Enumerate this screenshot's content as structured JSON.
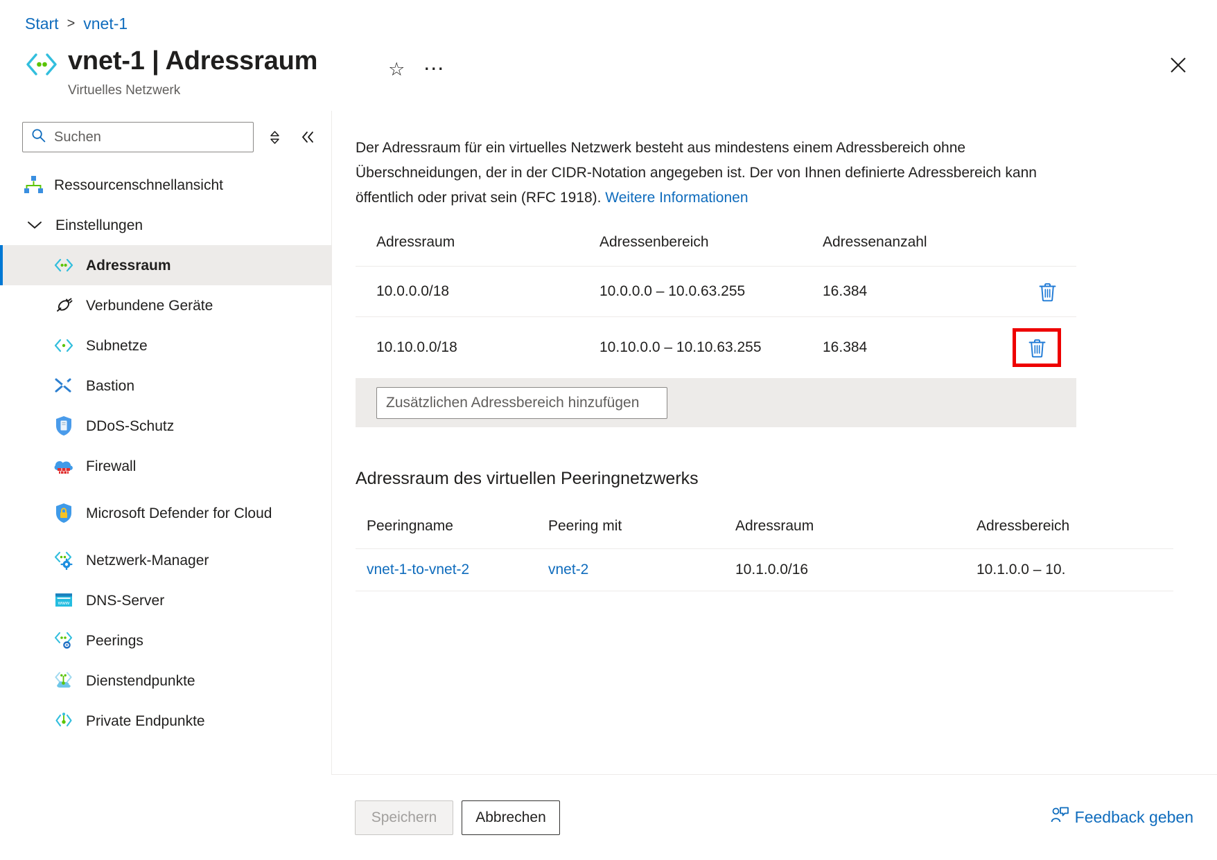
{
  "breadcrumb": {
    "home": "Start",
    "separator": ">",
    "current": "vnet-1"
  },
  "header": {
    "title": "vnet-1 | Adressraum",
    "subtitle": "Virtuelles Netzwerk",
    "favorite_icon": "star-icon",
    "more_icon": "ellipsis-icon",
    "close_icon": "close-icon",
    "resource_icon": "virtual-network-icon"
  },
  "search": {
    "placeholder": "Suchen",
    "value": "",
    "search_icon": "search-icon",
    "expand_icon": "expand-collapse-icon",
    "collapse_icon": "double-chevron-left-icon"
  },
  "sidebar": {
    "items": [
      {
        "label": "Ressourcenschnellansicht",
        "icon": "resource-visualizer-icon",
        "level": "top",
        "selected": false
      },
      {
        "label": "Einstellungen",
        "icon": "chevron-down-icon",
        "level": "group",
        "selected": false
      },
      {
        "label": "Adressraum",
        "icon": "address-space-icon",
        "level": "child",
        "selected": true
      },
      {
        "label": "Verbundene Geräte",
        "icon": "connected-devices-icon",
        "level": "child",
        "selected": false
      },
      {
        "label": "Subnetze",
        "icon": "subnets-icon",
        "level": "child",
        "selected": false
      },
      {
        "label": "Bastion",
        "icon": "bastion-icon",
        "level": "child",
        "selected": false
      },
      {
        "label": "DDoS-Schutz",
        "icon": "ddos-shield-icon",
        "level": "child",
        "selected": false
      },
      {
        "label": "Firewall",
        "icon": "firewall-cloud-icon",
        "level": "child",
        "selected": false
      },
      {
        "label": "Microsoft Defender for Cloud",
        "icon": "defender-lock-shield-icon",
        "level": "child",
        "selected": false
      },
      {
        "label": "Netzwerk-Manager",
        "icon": "network-manager-gear-icon",
        "level": "child",
        "selected": false
      },
      {
        "label": "DNS-Server",
        "icon": "dns-server-www-icon",
        "level": "child",
        "selected": false
      },
      {
        "label": "Peerings",
        "icon": "peerings-icon",
        "level": "child",
        "selected": false
      },
      {
        "label": "Dienstendpunkte",
        "icon": "service-endpoints-cloud-icon",
        "level": "child",
        "selected": false
      },
      {
        "label": "Private Endpunkte",
        "icon": "private-endpoints-icon",
        "level": "child",
        "selected": false
      }
    ]
  },
  "main": {
    "description_part1": "Der Adressraum für ein virtuelles Netzwerk besteht aus mindestens einem Adressbereich ohne Überschneidungen, der in der CIDR-Notation angegeben ist. Der von Ihnen definierte Adressbereich kann öffentlich oder privat sein (RFC 1918). ",
    "description_link": "Weitere Informationen",
    "address_table": {
      "headers": [
        "Adressraum",
        "Adressenbereich",
        "Adressenanzahl"
      ],
      "rows": [
        {
          "space": "10.0.0.0/18",
          "range": "10.0.0.0 – 10.0.63.255",
          "count": "16.384",
          "delete_icon": "trash-icon",
          "highlighted": false
        },
        {
          "space": "10.10.0.0/18",
          "range": "10.10.0.0 – 10.10.63.255",
          "count": "16.384",
          "delete_icon": "trash-icon",
          "highlighted": true
        }
      ],
      "add_placeholder": "Zusätzlichen Adressbereich hinzufügen",
      "add_value": ""
    },
    "peering_section_title": "Adressraum des virtuellen Peeringnetzwerks",
    "peering_table": {
      "headers": [
        "Peeringname",
        "Peering mit",
        "Adressraum",
        "Adressbereich"
      ],
      "rows": [
        {
          "name": "vnet-1-to-vnet-2",
          "peer_with": "vnet-2",
          "space": "10.1.0.0/16",
          "range": "10.1.0.0 – 10."
        }
      ]
    }
  },
  "footer": {
    "save_label": "Speichern",
    "cancel_label": "Abbrechen",
    "feedback_label": "Feedback geben",
    "feedback_icon": "feedback-person-icon"
  },
  "colors": {
    "accent": "#0078d4",
    "link": "#0f6cbd",
    "highlight": "#ee0000",
    "selected_bg": "#edebe9"
  }
}
